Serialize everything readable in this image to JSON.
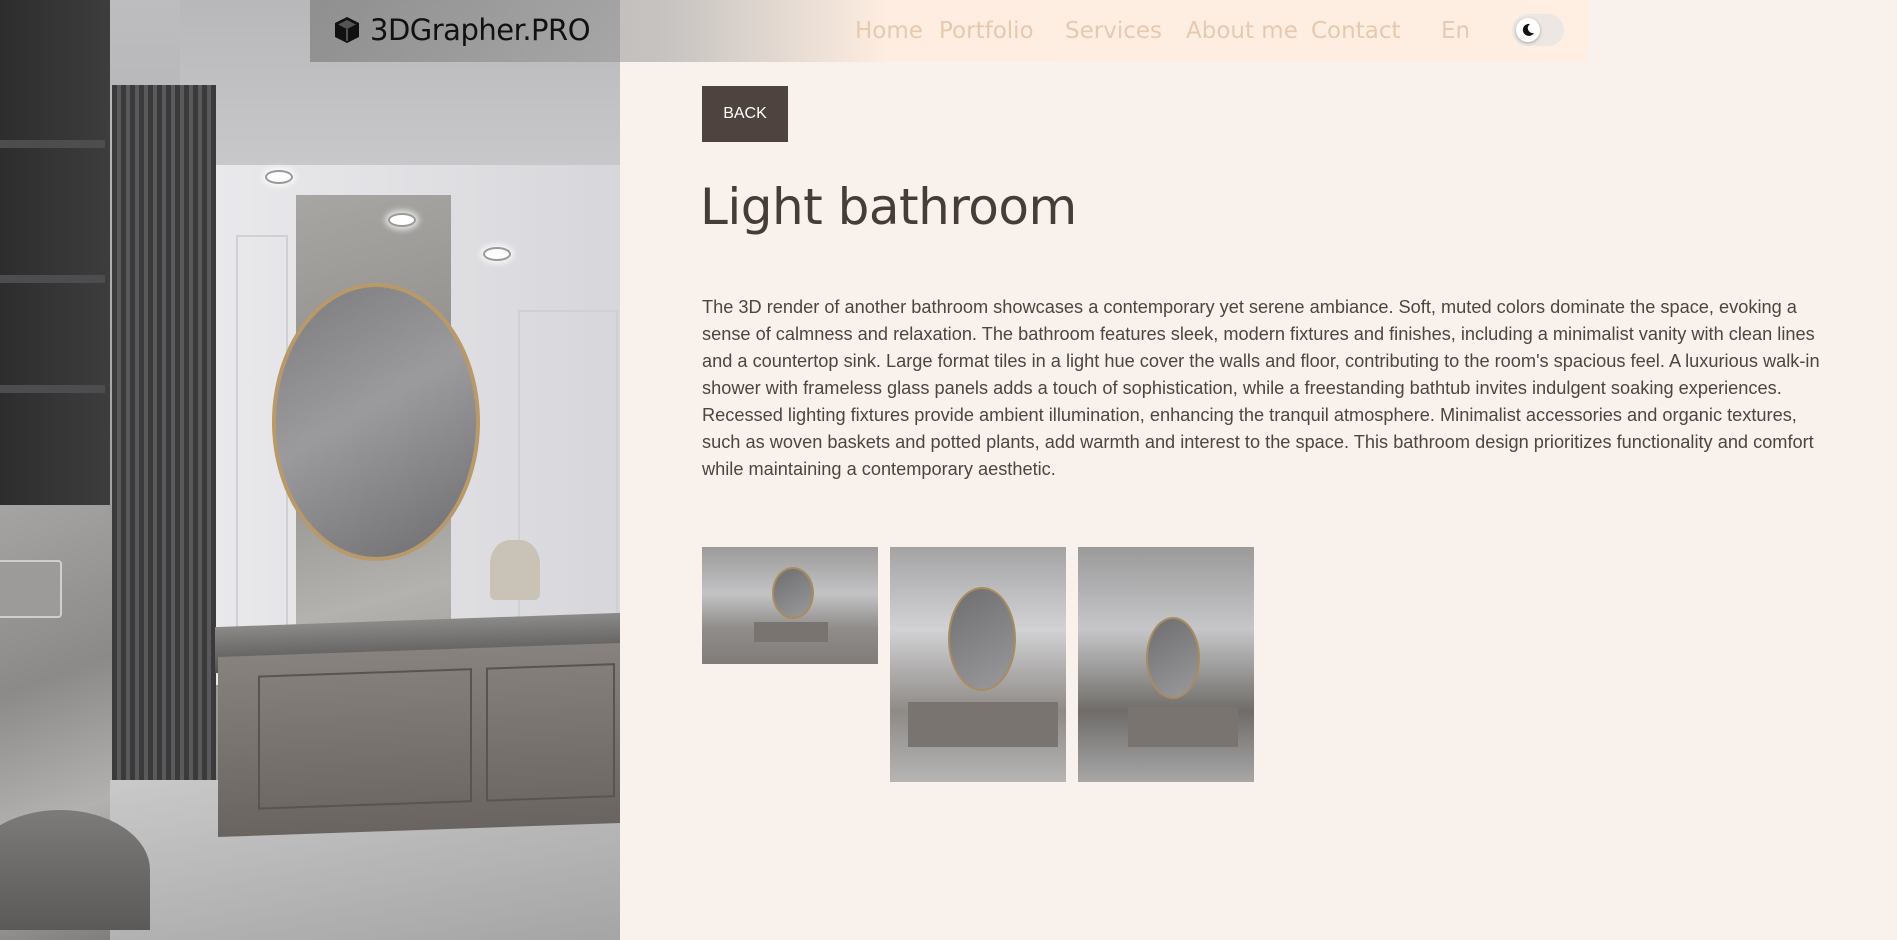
{
  "nav": {
    "logo_text": "3DGrapher.PRO",
    "links": [
      "Home",
      "Portfolio",
      "Services",
      "About me",
      "Contact"
    ],
    "language": "En",
    "link_color": "#e7c9ad"
  },
  "main": {
    "back_label": "BACK",
    "title": "Light bathroom",
    "description": "The 3D render of another bathroom showcases a contemporary yet serene ambiance. Soft, muted colors dominate the space, evoking a sense of calmness and relaxation. The bathroom features sleek, modern fixtures and finishes, including a minimalist vanity with clean lines and a countertop sink. Large format tiles in a light hue cover the walls and floor, contributing to the room's spacious feel. A luxurious walk-in shower with frameless glass panels adds a touch of sophistication, while a freestanding bathtub invites indulgent soaking experiences. Recessed lighting fixtures provide ambient illumination, enhancing the tranquil atmosphere. Minimalist accessories and organic textures, such as woven baskets and potted plants, add warmth and interest to the space. This bathroom design prioritizes functionality and comfort while maintaining a contemporary aesthetic."
  },
  "theme": {
    "background": "#f8f1ec",
    "button_bg": "#4e433e",
    "text": "#463c38"
  },
  "icons": {
    "logo": "cube-icon",
    "theme_toggle": "moon-icon"
  }
}
